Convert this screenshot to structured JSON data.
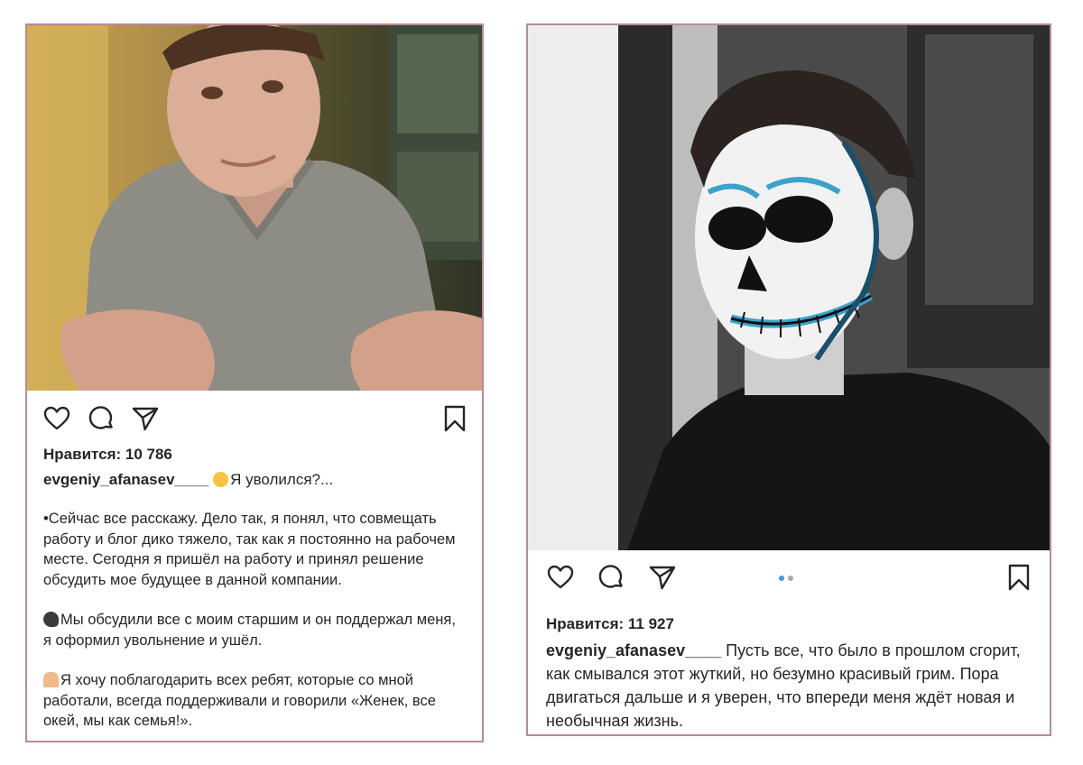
{
  "posts": [
    {
      "likes_text": "Нравится: 10 786",
      "username": "evgeniy_afanasev____",
      "title": "Я уволился?...",
      "paragraphs": [
        "•Сейчас все расскажу. Дело так, я понял, что совмещать работу и блог дико тяжело, так как я постоянно на рабочем месте. Сегодня я пришёл на работу и принял решение обсудить мое будущее в данной компании.",
        "Мы обсудили все с моим старшим и он поддержал меня, я оформил увольнение и ушёл.",
        "Я хочу поблагодарить всех ребят, которые со мной работали, всегда поддерживали и говорили «Женек, все окей, мы как семья!»."
      ],
      "emojis": [
        "smirk-face",
        "speaking-head",
        "folded-hands"
      ],
      "icons": [
        "heart-icon",
        "comment-icon",
        "share-icon",
        "bookmark-icon"
      ]
    },
    {
      "likes_text": "Нравится: 11 927",
      "username": "evgeniy_afanasev____",
      "caption": "Пусть все, что было в прошлом сгорит, как смывался этот жуткий, но безумно красивый грим. Пора двигаться дальше и я уверен, что впереди меня ждёт новая и необычная жизнь.",
      "carousel": {
        "count": 2,
        "active": 1
      },
      "icons": [
        "heart-icon",
        "comment-icon",
        "share-icon",
        "bookmark-icon"
      ]
    }
  ],
  "colors": {
    "frame_border": "#b98a98",
    "text": "#262626",
    "carousel_active": "#3897f0",
    "carousel_inactive": "#a8a8a8"
  }
}
